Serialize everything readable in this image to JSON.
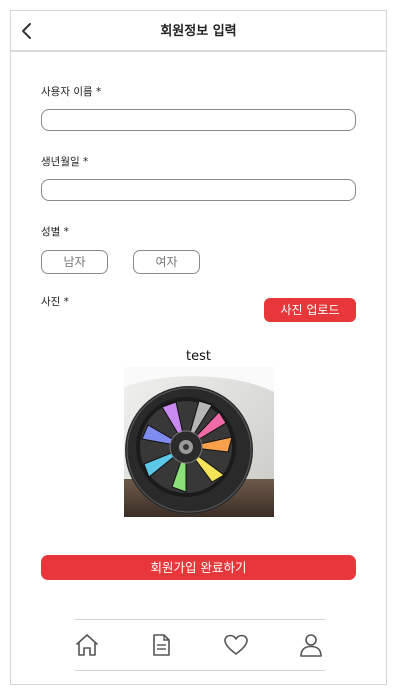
{
  "header": {
    "title": "회원정보 입력",
    "back_icon": "chevron-left-icon"
  },
  "form": {
    "name_label": "사용자 이름 *",
    "name_value": "",
    "birth_label": "생년월일 *",
    "birth_value": "",
    "gender_label": "성별 *",
    "gender_male": "남자",
    "gender_female": "여자",
    "photo_label": "사진 *",
    "upload_button": "사진 업로드",
    "photo_caption": "test",
    "submit_button": "회원가입 완료하기"
  },
  "bottom_nav": {
    "items": [
      {
        "icon": "home-icon"
      },
      {
        "icon": "document-icon"
      },
      {
        "icon": "heart-icon"
      },
      {
        "icon": "user-icon"
      }
    ]
  },
  "colors": {
    "accent": "#e8373a",
    "border": "#8a8a8a",
    "icon": "#555555"
  }
}
